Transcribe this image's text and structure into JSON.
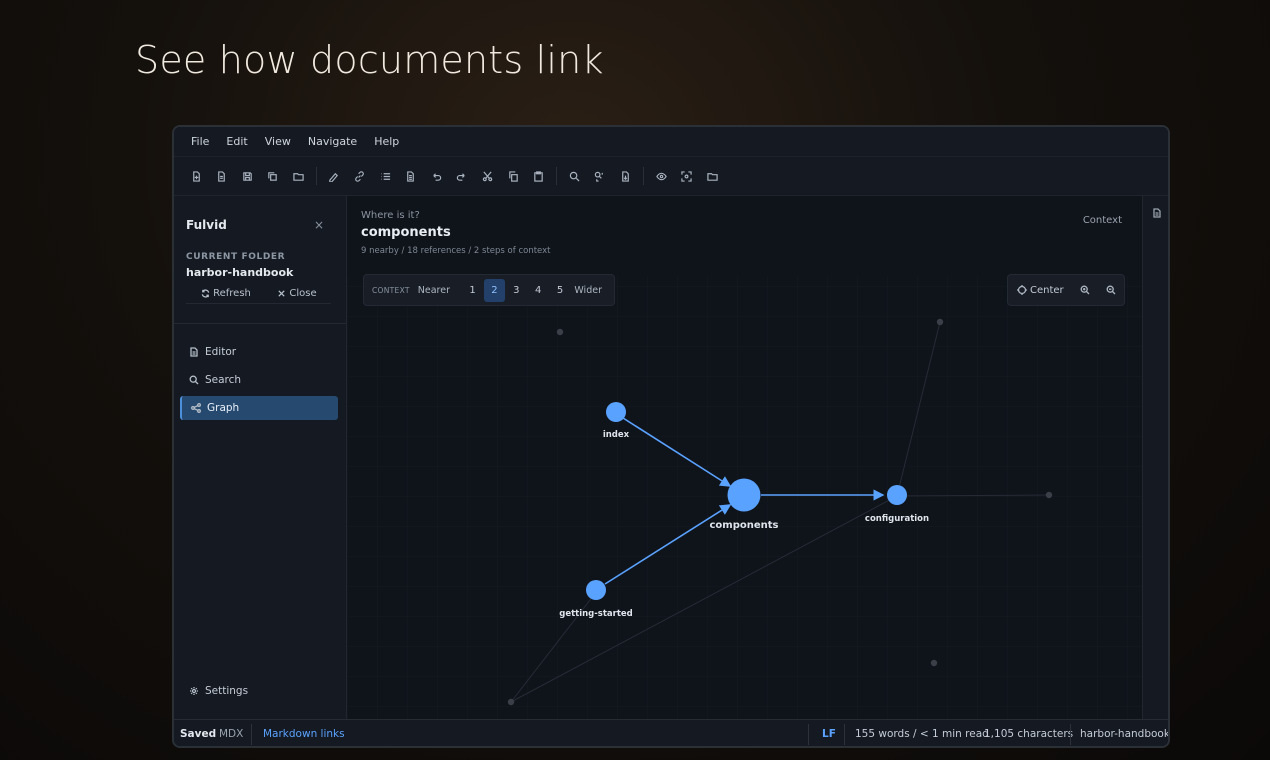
{
  "headline": "See how documents link",
  "menu": [
    "File",
    "Edit",
    "View",
    "Navigate",
    "Help"
  ],
  "toolbar_icons": [
    "new-file-icon",
    "document-icon",
    "save-icon",
    "copy-file-icon",
    "open-folder-icon",
    "format-icon",
    "link-icon",
    "list-icon",
    "page-icon",
    "undo-icon",
    "redo-icon",
    "cut-icon",
    "copy-icon",
    "paste-icon",
    "search-icon",
    "find-replace-icon",
    "export-icon",
    "preview-icon",
    "focus-icon",
    "folder-icon"
  ],
  "sidebar": {
    "title": "Fulvid",
    "close": "×",
    "folder_label": "CURRENT FOLDER",
    "folder_name": "harbor-handbook",
    "refresh": "Refresh",
    "close_folder": "Close",
    "nav": [
      {
        "label": "Editor",
        "icon": "document-icon"
      },
      {
        "label": "Search",
        "icon": "search-icon"
      },
      {
        "label": "Graph",
        "icon": "graph-icon",
        "active": true
      }
    ],
    "settings": "Settings"
  },
  "main": {
    "crumb": "Where is it?",
    "title": "components",
    "meta": "9 nearby / 18 references / 2 steps of context",
    "context_label": "Context",
    "context_bar": {
      "caption": "CONTEXT",
      "nearer": "Nearer",
      "levels": [
        "1",
        "2",
        "3",
        "4",
        "5"
      ],
      "selected": "2",
      "wider": "Wider"
    },
    "view_bar": {
      "center": "Center"
    }
  },
  "graph": {
    "nodes": [
      {
        "label": "index"
      },
      {
        "label": "components"
      },
      {
        "label": "configuration"
      },
      {
        "label": "getting-started"
      }
    ],
    "accent": "#5aa2ff",
    "faint": "#3a3f48"
  },
  "status": {
    "saved": "Saved",
    "format": "MDX",
    "links": "Markdown links",
    "eol": "LF",
    "words": "155 words / < 1 min read",
    "chars": "1,105 characters",
    "folder": "harbor-handbook"
  }
}
